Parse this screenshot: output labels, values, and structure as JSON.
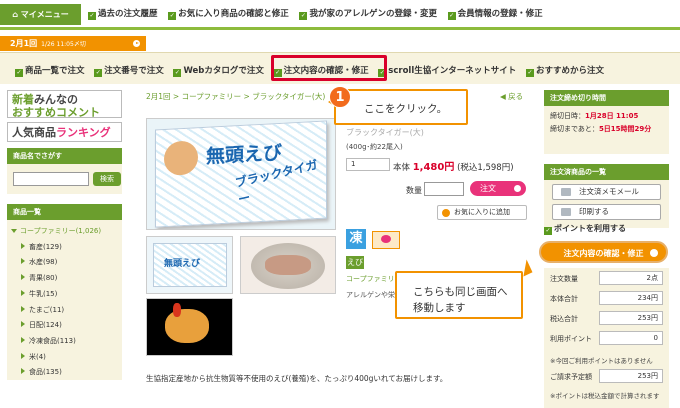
{
  "topnav": {
    "mymenu": "マイメニュー",
    "links": [
      "過去の注文履歴",
      "お気に入り商品の確認と修正",
      "我が家のアレルゲンの登録・変更",
      "会員情報の登録・修正"
    ]
  },
  "datebar": {
    "date": "2月1回",
    "deadline": "1/26 11:05〆切"
  },
  "subnav": {
    "links": [
      "商品一覧で注文",
      "注文番号で注文",
      "Webカタログで注文",
      "注文内容の確認・修正",
      "scroll生協インターネットサイト",
      "おすすめから注文"
    ]
  },
  "sidebar": {
    "promo1_a": "新着",
    "promo1_b": "みんなの",
    "promo1_c": "おすすめコメント",
    "promo2_a": "人気商品",
    "promo2_b": "ランキング",
    "search_title": "商品名でさがす",
    "search_button": "検索",
    "category_title": "商品一覧",
    "categories": [
      {
        "label": "コープファミリー(1,026)"
      },
      {
        "label": "畜産(129)"
      },
      {
        "label": "水産(98)"
      },
      {
        "label": "青果(80)"
      },
      {
        "label": "牛乳(15)"
      },
      {
        "label": "たまご(11)"
      },
      {
        "label": "日配(124)"
      },
      {
        "label": "冷凍食品(113)"
      },
      {
        "label": "米(4)"
      },
      {
        "label": "食品(135)"
      }
    ]
  },
  "main": {
    "breadcrumb": "2月1回 > コープファミリー > ブラックタイガー(大)",
    "back": "戻る",
    "box_title": "無頭えび",
    "box_sub": "ブラックタイガー",
    "thumb_title": "無頭えび",
    "product_name": "ブラックタイガー(大)",
    "product_desc": "(400g･約22尾入)",
    "qty_default": "1",
    "price_label": "本体",
    "price": "1,480",
    "price_unit": "円",
    "price_tax": "(税込1,598円)",
    "qty_label": "数量",
    "order_button": "注文",
    "fav_button": "お気に入りに追加",
    "frozen_icon": "凍",
    "ebi_tag": "えび",
    "cofa_text": "コープファミリー",
    "allergen_text": "アレルゲンや栄",
    "description": "生協指定産地から抗生物質等不使用のえび(養殖)を、たっぷり400gいれてお届けします。"
  },
  "right": {
    "deadline_title": "注文締め切り時間",
    "deadline_line1_pre": "締切日時：",
    "deadline_line1_val": "1月28日 11:05",
    "deadline_line2_pre": "締切まであと：",
    "deadline_line2_val": "5日15時間29分",
    "cart_title": "注文済商品の一覧",
    "memo_button": "注文済メモメール",
    "print_button": "印刷する",
    "point_link": "ポイントを利用する",
    "confirm_button": "注文内容の確認・修正",
    "rows": [
      {
        "label": "注文数量",
        "value": "2点"
      },
      {
        "label": "本体合計",
        "value": "234円"
      },
      {
        "label": "税込合計",
        "value": "253円"
      },
      {
        "label": "利用ポイント",
        "value": "0"
      }
    ],
    "note1": "※今回ご利用ポイントはありません",
    "total_label": "ご請求予定額",
    "total_value": "253円",
    "note2": "※ポイントは税込金額で計算されます"
  },
  "callouts": {
    "step_number": "1",
    "callout1": "ここをクリック。",
    "callout2_line1": "こちらも同じ画面へ",
    "callout2_line2": "移動します"
  }
}
